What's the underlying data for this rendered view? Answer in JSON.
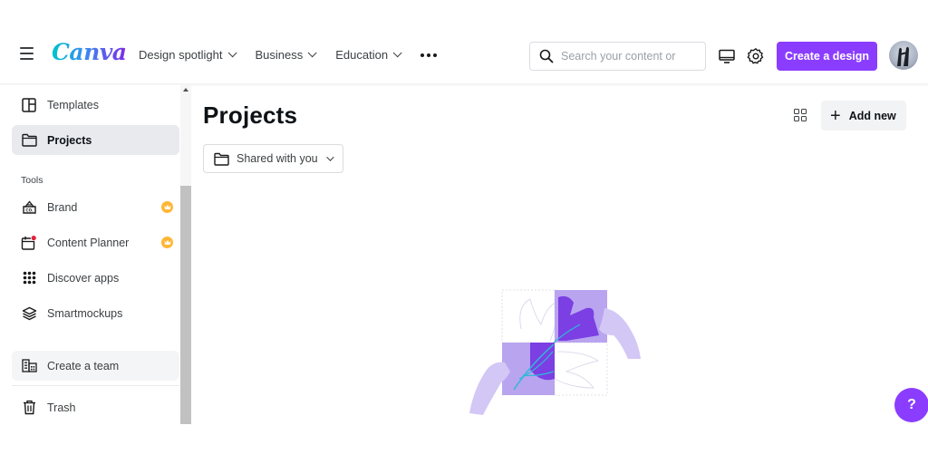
{
  "header": {
    "logo": "Canva",
    "nav": [
      {
        "label": "Design spotlight"
      },
      {
        "label": "Business"
      },
      {
        "label": "Education"
      }
    ],
    "more_icon": "more-horizontal-icon",
    "search": {
      "placeholder": "Search your content or",
      "value": ""
    },
    "create_button": "Create a design",
    "brand_color": "#8b3dff"
  },
  "sidebar": {
    "items": [
      {
        "label": "Templates",
        "icon": "templates-icon"
      },
      {
        "label": "Projects",
        "icon": "folder-icon",
        "active": true
      }
    ],
    "tools_heading": "Tools",
    "tools": [
      {
        "label": "Brand",
        "icon": "brand-kit-icon",
        "premium": true
      },
      {
        "label": "Content Planner",
        "icon": "calendar-icon",
        "premium": true,
        "notification": true
      },
      {
        "label": "Discover apps",
        "icon": "apps-grid-icon"
      },
      {
        "label": "Smartmockups",
        "icon": "layers-icon"
      }
    ],
    "create_team": "Create a team",
    "trash": "Trash"
  },
  "main": {
    "title": "Projects",
    "filter": "Shared with you",
    "add_new": "Add new",
    "empty_state_illustration": "puzzle-hands-illustration"
  },
  "help": {
    "label": "?"
  }
}
